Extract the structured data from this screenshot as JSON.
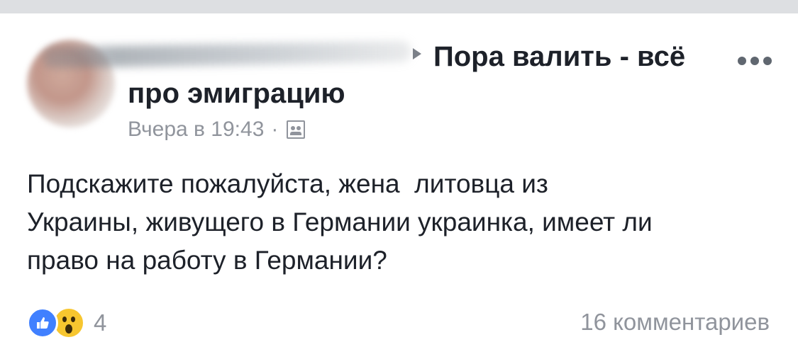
{
  "post": {
    "group_name_part1": "Пора валить - всё",
    "group_name_part2": "про эмиграцию",
    "timestamp": "Вчера в 19:43",
    "separator": "·",
    "audience_icon": "group-icon",
    "body": "Подскажите пожалуйста, жена  литовца из\nУкраины, живущего в Германии украинка, имеет ли\nправо на работу в Германии?"
  },
  "reactions": {
    "icons": [
      "like-icon",
      "wow-icon"
    ],
    "count": "4"
  },
  "comments": {
    "label": "16 комментариев"
  },
  "colors": {
    "top_bar": "#dddfe2",
    "text_primary": "#1d2129",
    "text_secondary": "#90949c",
    "like_blue": "#4080ff",
    "wow_yellow": "#f7c62f"
  }
}
